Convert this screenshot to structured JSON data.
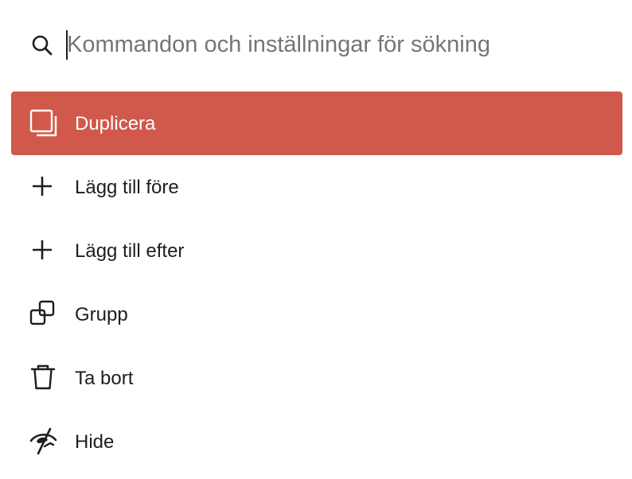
{
  "search": {
    "placeholder": "Kommandon och inställningar för sökning",
    "value": ""
  },
  "commands": [
    {
      "label": "Duplicera",
      "icon": "duplicate-icon",
      "selected": true
    },
    {
      "label": "Lägg till före",
      "icon": "plus-icon",
      "selected": false
    },
    {
      "label": "Lägg till efter",
      "icon": "plus-icon",
      "selected": false
    },
    {
      "label": "Grupp",
      "icon": "group-icon",
      "selected": false
    },
    {
      "label": "Ta bort",
      "icon": "trash-icon",
      "selected": false
    },
    {
      "label": "Hide",
      "icon": "hide-icon",
      "selected": false
    }
  ],
  "colors": {
    "selected_background": "#d0594b",
    "selected_text": "#ffffff",
    "text": "#1e1e1e",
    "placeholder": "#757575"
  }
}
